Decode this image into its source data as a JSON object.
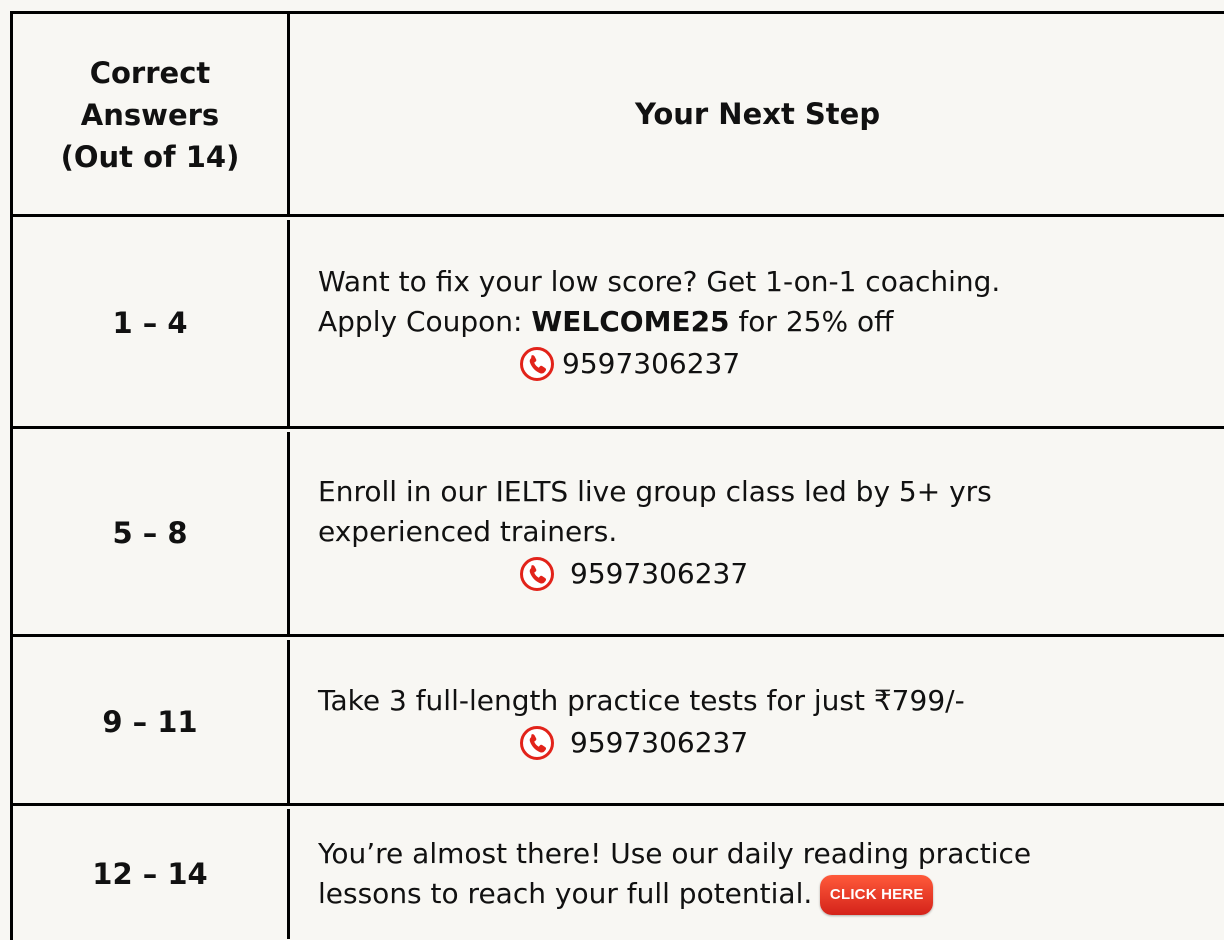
{
  "header": {
    "col1_line1": "Correct",
    "col1_line2": "Answers",
    "col1_line3": "(Out of 14)",
    "col2": "Your Next Step"
  },
  "rows": [
    {
      "range": "1 – 4",
      "line1": "Want to fix your low score? Get 1-on-1 coaching.",
      "line2_prefix": "Apply Coupon: ",
      "coupon_code": "WELCOME25",
      "line2_suffix": " for 25% off",
      "phone": "9597306237",
      "phone_icon": "phone-icon"
    },
    {
      "range": "5 –  8",
      "line1": "Enroll in our IELTS live group class led by 5+ yrs",
      "line2": "experienced trainers.",
      "phone": "9597306237",
      "phone_icon": "phone-icon"
    },
    {
      "range": "9 – 11",
      "line1": "Take 3 full-length practice tests for just ₹799/-",
      "phone": "9597306237",
      "phone_icon": "phone-icon"
    },
    {
      "range": "12 – 14",
      "line1": "You’re almost there! Use our daily reading practice",
      "line2": "lessons to reach your full potential.",
      "button_label": "CLICK HERE"
    }
  ],
  "colors": {
    "background": "#f8f7f3",
    "border": "#000000",
    "icon_red": "#e2231a",
    "button_red": "#d4231a"
  }
}
